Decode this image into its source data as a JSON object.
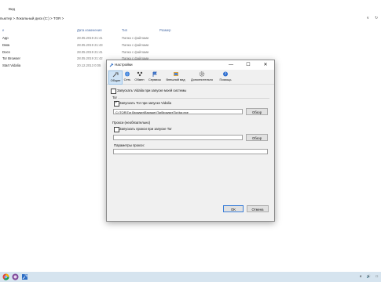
{
  "explorer": {
    "ribbon_tab": "Вид",
    "breadcrumb": "пьютер > Локальный диск (C:) > TOR >",
    "addr_right": [
      "∨",
      "↻"
    ],
    "columns": {
      "name": "е",
      "date": "Дата изменения",
      "type": "Тип",
      "size": "Размер"
    },
    "files": [
      {
        "name": "App",
        "date": "28.05.2019 21:41",
        "type": "Папка с файлами"
      },
      {
        "name": "Data",
        "date": "28.05.2019 21:43",
        "type": "Папка с файлами"
      },
      {
        "name": "Docs",
        "date": "28.05.2019 21:41",
        "type": "Папка с файлами"
      },
      {
        "name": "Tor Browser",
        "date": "28.05.2019 21:42",
        "type": "Папка с файлами"
      },
      {
        "name": "Start Vidalia",
        "date": "20.12.2013 0:05",
        "type": "Приложение"
      }
    ]
  },
  "dialog": {
    "title": "Настройки",
    "controls": {
      "minimize": "—",
      "maximize": "☐",
      "close": "✕"
    },
    "tabs": [
      {
        "label": "Общие",
        "icon": "wrench-icon"
      },
      {
        "label": "Сеть",
        "icon": "globe-icon"
      },
      {
        "label": "Обмен",
        "icon": "share-icon"
      },
      {
        "label": "Сервисы",
        "icon": "flag-icon"
      },
      {
        "label": "Внешний вид",
        "icon": "appearance-icon"
      },
      {
        "label": "Дополнительно",
        "icon": "gear-icon"
      },
      {
        "label": "Помощь",
        "icon": "help-icon"
      }
    ],
    "general": {
      "start_vidalia_label": "Запускать Vidalia при запуске моей системы",
      "tor_group": "Tor",
      "start_tor_label": "Запускать Tor при запуске Vidalia",
      "tor_path": "C:\\TOR\\Tor Browser\\Browser\\TorBrowser\\Tor\\tor.exe",
      "browse1": "Обзор",
      "proxy_group": "Прокси (необязательно)",
      "start_proxy_label": "Запускать прокси при запуске Tor",
      "proxy_path": "",
      "browse2": "Обзор",
      "proxy_params_label": "Параметры прокси:",
      "proxy_params": ""
    },
    "ok": "OK",
    "cancel": "Отмена"
  },
  "taskbar": {
    "tray": [
      "∧",
      "🔊",
      "□"
    ]
  },
  "colors": {
    "accent": "#3c7fd8",
    "active_tab": "#cfe3f5",
    "taskbar": "#d6e4ef",
    "link_header": "#4d6fa8"
  }
}
